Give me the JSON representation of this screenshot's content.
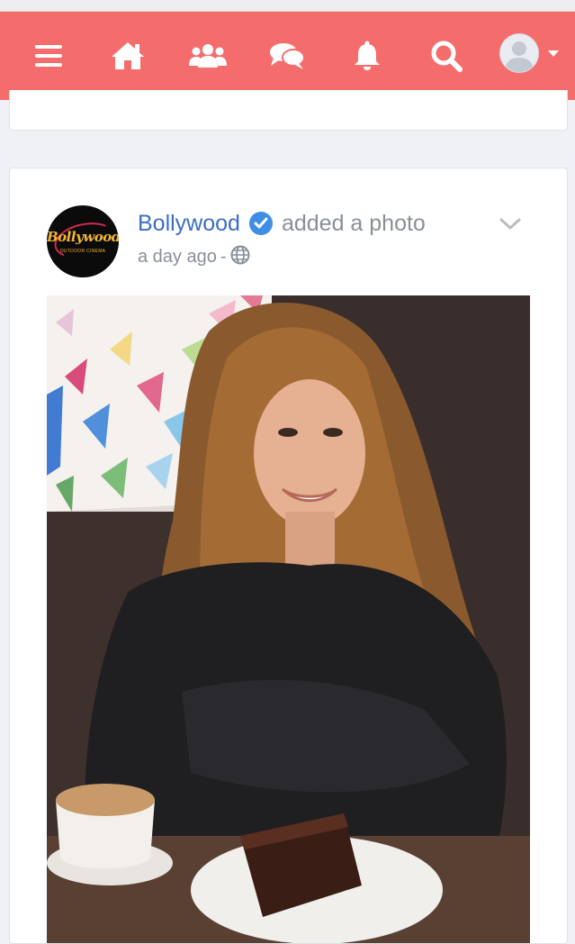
{
  "nav": {
    "items": [
      {
        "icon": "menu-icon"
      },
      {
        "icon": "home-icon"
      },
      {
        "icon": "users-icon"
      },
      {
        "icon": "chat-icon"
      },
      {
        "icon": "bell-icon"
      },
      {
        "icon": "search-icon"
      }
    ],
    "avatar_icon": "user-avatar-icon",
    "bar_color": "#f56c6c"
  },
  "post": {
    "author": "Bollywood",
    "verified": true,
    "action": "added a photo",
    "time": "a day ago",
    "separator": "-",
    "privacy_icon": "globe-icon",
    "avatar_logo_text": "Bollywood",
    "avatar_logo_subtext": "OUTDOOR CINEMA",
    "photo_alt": "Woman with long wavy hair smiling at a cafe table with coffee and chocolate cake, butterfly wall art behind"
  },
  "colors": {
    "author_link": "#3b6ec4",
    "verified_badge": "#3e8ee3",
    "muted_text": "#8a8f99"
  }
}
